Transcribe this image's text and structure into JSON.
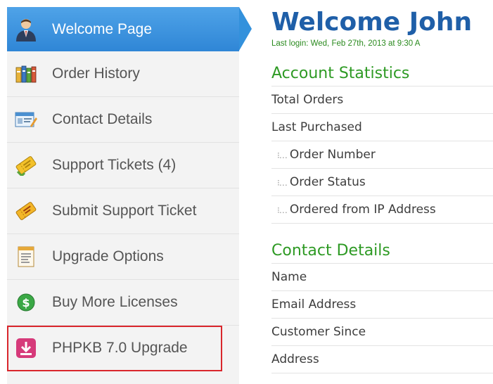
{
  "sidebar": {
    "items": [
      {
        "label": "Welcome Page",
        "icon": "user-avatar-icon"
      },
      {
        "label": "Order History",
        "icon": "books-icon"
      },
      {
        "label": "Contact Details",
        "icon": "contact-card-icon"
      },
      {
        "label": "Support Tickets (4)",
        "icon": "ticket-icon"
      },
      {
        "label": "Submit Support Ticket",
        "icon": "ticket-submit-icon"
      },
      {
        "label": "Upgrade Options",
        "icon": "document-icon"
      },
      {
        "label": "Buy More Licenses",
        "icon": "dollar-coin-icon"
      },
      {
        "label": "PHPKB 7.0 Upgrade",
        "icon": "download-icon"
      }
    ]
  },
  "main": {
    "title": "Welcome John",
    "last_login": "Last login: Wed, Feb 27th, 2013 at 9:30 A",
    "account_statistics": {
      "heading": "Account Statistics",
      "rows": [
        "Total Orders",
        "Last Purchased",
        "Order Number",
        "Order Status",
        "Ordered from IP Address"
      ]
    },
    "contact_details": {
      "heading": "Contact Details",
      "rows": [
        "Name",
        "Email Address",
        "Customer Since",
        "Address"
      ]
    }
  },
  "colors": {
    "active_nav": "#3391dc",
    "title_blue": "#1f5fa8",
    "section_green": "#2e9a24",
    "highlight_red": "#d9262c"
  }
}
